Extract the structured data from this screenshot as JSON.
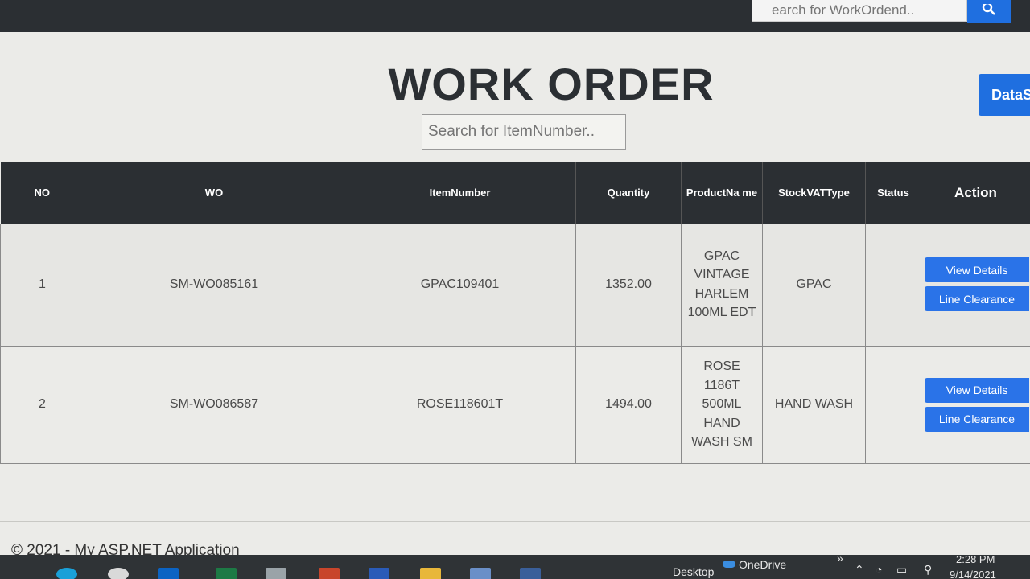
{
  "navbar": {
    "search_placeholder": "earch for WorkOrdend..",
    "search_icon": "magnifier"
  },
  "page": {
    "title": "WORK ORDER",
    "search_placeholder": "Search for ItemNumber..",
    "dataset_button": "DataS"
  },
  "table": {
    "headers": [
      "NO",
      "WO",
      "ItemNumber",
      "Quantity",
      "ProductNa me",
      "StockVATType",
      "Status",
      "Action"
    ],
    "rows": [
      {
        "no": "1",
        "wo": "SM-WO085161",
        "item": "GPAC109401",
        "qty": "1352.00",
        "product": "GPAC VINTAGE HARLEM 100ML EDT",
        "vat": "GPAC",
        "status": "",
        "view": "View Details",
        "clear": "Line Clearance"
      },
      {
        "no": "2",
        "wo": "SM-WO086587",
        "item": "ROSE118601T",
        "qty": "1494.00",
        "product": "ROSE 1186T 500ML HAND WASH SM",
        "vat": "HAND WASH",
        "status": "",
        "view": "View Details",
        "clear": "Line Clearance"
      }
    ]
  },
  "footer": {
    "text": "© 2021 - My ASP.NET Application"
  },
  "taskbar": {
    "desktop": "Desktop",
    "onedrive": "OneDrive",
    "chevron": "»",
    "time": "2:28 PM",
    "date": "9/14/2021"
  },
  "colors": {
    "navbar": "#2b2f33",
    "accent": "#2a73e8",
    "header": "#2b2f33"
  }
}
